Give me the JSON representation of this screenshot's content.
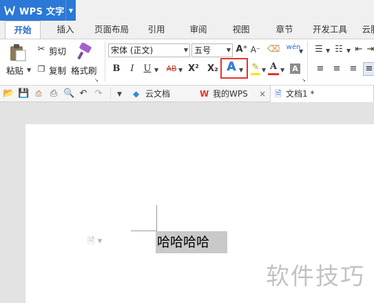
{
  "app": {
    "title": "WPS 文字"
  },
  "menu_tabs": [
    "开始",
    "插入",
    "页面布局",
    "引用",
    "审阅",
    "视图",
    "章节",
    "开发工具",
    "云服"
  ],
  "ribbon": {
    "paste": "粘贴",
    "cut": "剪切",
    "copy": "复制",
    "format_painter": "格式刷",
    "font_name": "宋体 (正文)",
    "font_size": "五号",
    "bold": "B",
    "italic": "I",
    "underline": "U",
    "strike": "AB",
    "superscript": "X²",
    "subscript": "X₂",
    "text_effect": "A",
    "font_color": "A",
    "grow_font": "A⁺",
    "shrink_font": "A⁻",
    "pinyin": "wén",
    "highlight_color": "#e5322d",
    "font_color_bar": "#e5322d"
  },
  "doc_tabs": [
    {
      "label": "云文档"
    },
    {
      "label": "我的WPS"
    },
    {
      "label": "文档1 *"
    }
  ],
  "document": {
    "text": "哈哈哈哈"
  },
  "watermark": "软件技巧"
}
